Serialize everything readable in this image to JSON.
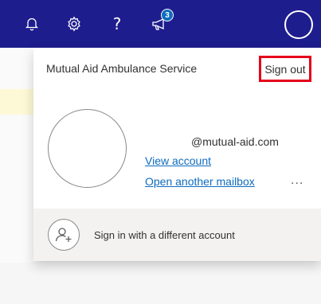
{
  "topbar": {
    "icons": [
      "bell-icon",
      "gear-icon",
      "help-icon",
      "megaphone-icon"
    ],
    "help_glyph": "?",
    "badge_count": "3",
    "background_color": "#1e1d8e"
  },
  "account_panel": {
    "organization": "Mutual Aid Ambulance Service",
    "sign_out_label": "Sign out",
    "email": "@mutual-aid.com",
    "view_account_label": "View account",
    "open_mailbox_label": "Open another mailbox",
    "more_label": "...",
    "sign_in_different_label": "Sign in with a different account",
    "link_color": "#0f6cbd",
    "highlight_color": "#e5001a"
  }
}
